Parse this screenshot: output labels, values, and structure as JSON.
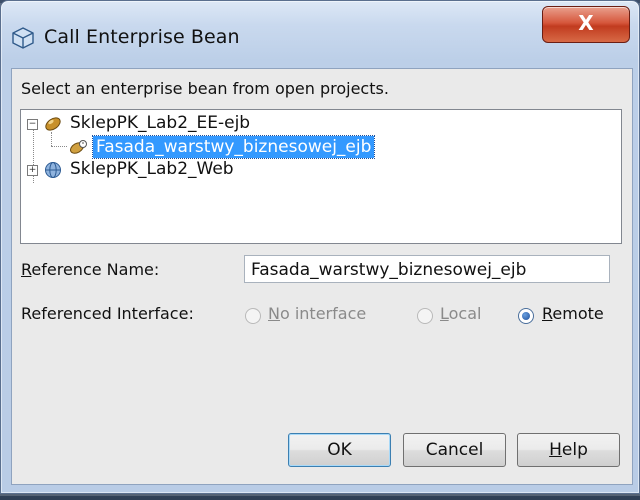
{
  "dialog": {
    "title": "Call Enterprise Bean",
    "close_glyph": "X",
    "instruction": "Select an enterprise bean from open projects.",
    "tree": {
      "nodes": [
        {
          "label": "SklepPK_Lab2_EE-ejb",
          "expander": "−",
          "icon": "ejb-module-icon"
        },
        {
          "label": "Fasada_warstwy_biznesowej_ejb",
          "icon": "session-bean-icon",
          "selected": true
        },
        {
          "label": "SklepPK_Lab2_Web",
          "expander": "+",
          "icon": "web-module-icon"
        }
      ]
    },
    "reference_name": {
      "label_mnemonic": "R",
      "label_rest": "eference Name:",
      "value": "Fasada_warstwy_biznesowej_ejb"
    },
    "referenced_interface": {
      "label": "Referenced Interface:",
      "options": [
        {
          "mnemonic": "N",
          "rest": "o interface",
          "selected": false,
          "enabled": false
        },
        {
          "mnemonic": "L",
          "rest": "ocal",
          "selected": false,
          "enabled": false
        },
        {
          "mnemonic": "R",
          "rest": "emote",
          "selected": true,
          "enabled": true
        }
      ]
    },
    "buttons": {
      "ok": "OK",
      "cancel": "Cancel",
      "help_mnemonic": "H",
      "help_rest": "elp"
    }
  }
}
